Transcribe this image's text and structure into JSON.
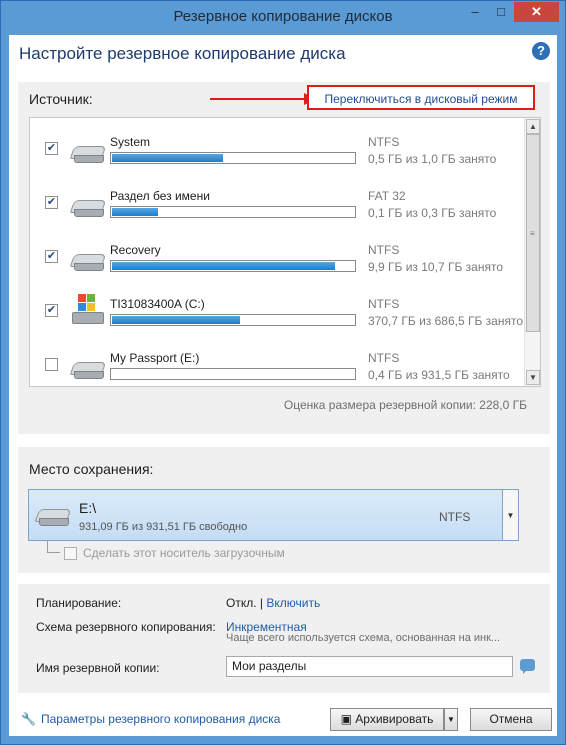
{
  "window": {
    "title": "Резервное копирование дисков",
    "minimize": "–",
    "maximize": "□",
    "close": "✕"
  },
  "heading": "Настройте резервное копирование диска",
  "help": "?",
  "source": {
    "label": "Источник:",
    "switch_link": "Переключиться в дисковый режим",
    "partitions": [
      {
        "name": "System",
        "fs": "NTFS",
        "used": "0,5 ГБ из 1,0 ГБ занято",
        "fill": 0.46,
        "checked": true,
        "icon": "drive-icon"
      },
      {
        "name": "Раздел без имени",
        "fs": "FAT 32",
        "used": "0,1 ГБ из 0,3 ГБ занято",
        "fill": 0.19,
        "checked": true,
        "icon": "drive-icon"
      },
      {
        "name": "Recovery",
        "fs": "NTFS",
        "used": "9,9 ГБ из 10,7 ГБ занято",
        "fill": 0.92,
        "checked": true,
        "icon": "drive-icon"
      },
      {
        "name": "TI31083400A (C:)",
        "fs": "NTFS",
        "used": "370,7 ГБ из 686,5 ГБ занято",
        "fill": 0.53,
        "checked": true,
        "icon": "windows-drive-icon"
      },
      {
        "name": "My Passport (E:)",
        "fs": "NTFS",
        "used": "0,4 ГБ из 931,5 ГБ занято",
        "fill": 0.0,
        "checked": false,
        "icon": "drive-icon"
      }
    ],
    "estimate": "Оценка размера резервной копии: 228,0 ГБ"
  },
  "destination": {
    "label": "Место сохранения:",
    "path": "E:\\",
    "free": "931,09 ГБ из 931,51 ГБ свободно",
    "fs": "NTFS",
    "bootable": "Сделать этот носитель загрузочным"
  },
  "schedule": {
    "label": "Планирование:",
    "value": "Откл.",
    "separator": "|",
    "enable_link": "Включить"
  },
  "scheme": {
    "label": "Схема резервного копирования:",
    "value": "Инкрементная",
    "description": "Чаще всего используется схема, основанная на инк..."
  },
  "backup_name": {
    "label": "Имя резервной копии:",
    "value": "Мои разделы"
  },
  "footer": {
    "params_link": "Параметры резервного копирования диска",
    "archive_button": "Архивировать",
    "cancel_button": "Отмена"
  },
  "colors": {
    "accent": "#5b9bd5",
    "bar_fill": "#1b7fcd",
    "highlight": "#e01b1b",
    "link": "#1f5ca8"
  }
}
